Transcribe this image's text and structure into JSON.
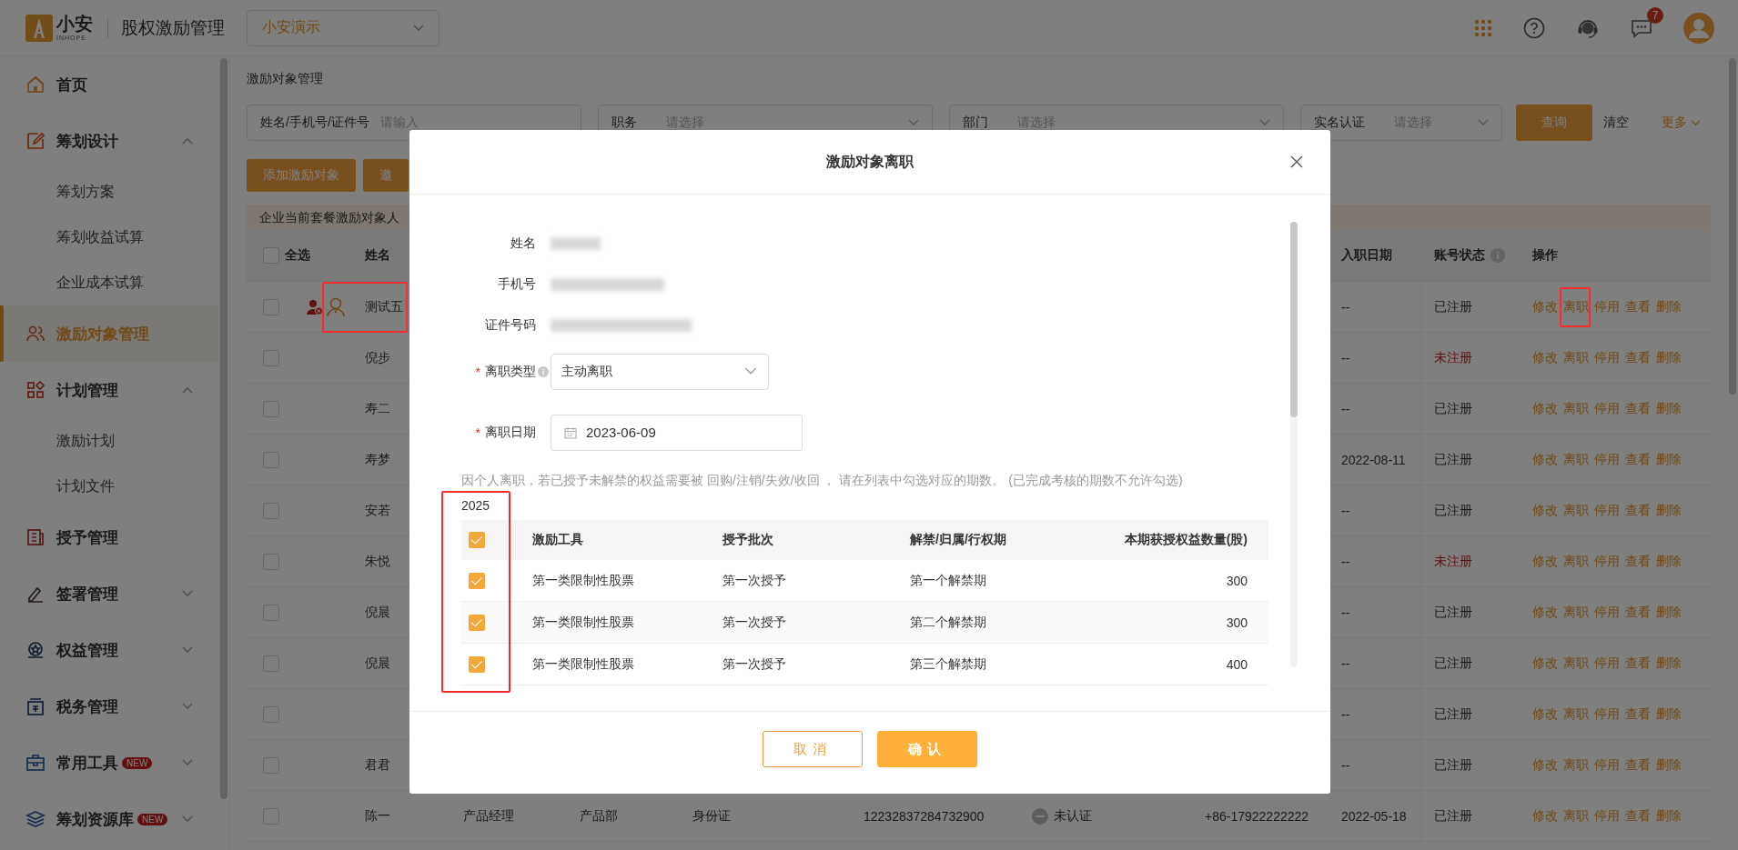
{
  "header": {
    "logo_text": "小安",
    "logo_sub": "INHOPE",
    "app_title": "股权激励管理",
    "company_select": "小安演示",
    "notification_count": "7"
  },
  "sidebar": {
    "items": [
      {
        "kind": "link",
        "label": "首页",
        "selected": false
      },
      {
        "kind": "group",
        "label": "筹划设计",
        "expanded": true,
        "selected": false,
        "children": [
          {
            "label": "筹划方案",
            "selected": false
          },
          {
            "label": "筹划收益试算",
            "selected": false
          },
          {
            "label": "企业成本试算",
            "selected": false
          }
        ]
      },
      {
        "kind": "link",
        "label": "激励对象管理",
        "selected": true
      },
      {
        "kind": "group",
        "label": "计划管理",
        "expanded": true,
        "selected": false,
        "children": [
          {
            "label": "激励计划",
            "selected": false
          },
          {
            "label": "计划文件",
            "selected": false
          }
        ]
      },
      {
        "kind": "link",
        "label": "授予管理",
        "selected": false
      },
      {
        "kind": "group",
        "label": "签署管理",
        "expanded": false,
        "selected": false
      },
      {
        "kind": "group",
        "label": "权益管理",
        "expanded": false,
        "selected": false
      },
      {
        "kind": "group",
        "label": "税务管理",
        "expanded": false,
        "selected": false
      },
      {
        "kind": "group",
        "label": "常用工具",
        "expanded": false,
        "selected": false,
        "badge": "NEW"
      },
      {
        "kind": "group",
        "label": "筹划资源库",
        "expanded": false,
        "selected": false,
        "badge": "NEW"
      }
    ]
  },
  "page": {
    "breadcrumb": "激励对象管理",
    "filters": [
      {
        "kind": "input",
        "label": "姓名/手机号/证件号",
        "placeholder": "请输入"
      },
      {
        "kind": "select",
        "label": "职务",
        "placeholder": "请选择"
      },
      {
        "kind": "select",
        "label": "部门",
        "placeholder": "请选择"
      },
      {
        "kind": "select",
        "label": "实名认证",
        "placeholder": "请选择"
      }
    ],
    "search_button": "查询",
    "clear_link": "清空",
    "more_link": "更多",
    "action_buttons": [
      "添加激励对象",
      "邀"
    ],
    "notice": "企业当前套餐激励对象人",
    "table": {
      "select_all": "全选",
      "select_all_checked": false,
      "name_column": "姓名",
      "right_columns": [
        {
          "label": "入职日期",
          "info": false
        },
        {
          "label": "账号状态",
          "info": true
        },
        {
          "label": "操作",
          "info": false
        }
      ],
      "rows": [
        {
          "checked": false,
          "tagged": true,
          "framed": true,
          "name": "测试五",
          "hire_date": "--",
          "status": "已注册",
          "registered": true,
          "actions": [
            "修改",
            "离职",
            "停用",
            "查看",
            "删除"
          ]
        },
        {
          "checked": false,
          "tagged": false,
          "framed": false,
          "name": "倪步",
          "hire_date": "--",
          "status": "未注册",
          "registered": false,
          "actions": [
            "修改",
            "离职",
            "停用",
            "查看",
            "删除"
          ]
        },
        {
          "checked": false,
          "tagged": false,
          "framed": false,
          "name": "寿二",
          "hire_date": "--",
          "status": "已注册",
          "registered": true,
          "actions": [
            "修改",
            "离职",
            "停用",
            "查看",
            "删除"
          ]
        },
        {
          "checked": false,
          "tagged": false,
          "framed": false,
          "name": "寿梦",
          "hire_date": "2022-08-11",
          "status": "已注册",
          "registered": true,
          "actions": [
            "修改",
            "离职",
            "停用",
            "查看",
            "删除"
          ]
        },
        {
          "checked": false,
          "tagged": false,
          "framed": false,
          "name": "安若",
          "hire_date": "--",
          "status": "已注册",
          "registered": true,
          "actions": [
            "修改",
            "离职",
            "停用",
            "查看",
            "删除"
          ]
        },
        {
          "checked": false,
          "tagged": false,
          "framed": false,
          "name": "朱悦",
          "hire_date": "--",
          "status": "未注册",
          "registered": false,
          "actions": [
            "修改",
            "离职",
            "停用",
            "查看",
            "删除"
          ]
        },
        {
          "checked": false,
          "tagged": false,
          "framed": false,
          "name": "倪晨",
          "hire_date": "--",
          "status": "已注册",
          "registered": true,
          "actions": [
            "修改",
            "离职",
            "停用",
            "查看",
            "删除"
          ]
        },
        {
          "checked": false,
          "tagged": false,
          "framed": false,
          "name": "倪晨",
          "hire_date": "--",
          "status": "已注册",
          "registered": true,
          "actions": [
            "修改",
            "离职",
            "停用",
            "查看",
            "删除"
          ]
        },
        {
          "checked": false,
          "tagged": false,
          "framed": false,
          "hire_date": "--",
          "status": "已注册",
          "registered": true,
          "actions": [
            "修改",
            "离职",
            "停用",
            "查看",
            "删除"
          ]
        },
        {
          "checked": false,
          "tagged": false,
          "framed": false,
          "name": "君君",
          "hire_date": "--",
          "status": "已注册",
          "registered": true,
          "actions": [
            "修改",
            "离职",
            "停用",
            "查看",
            "删除"
          ]
        },
        {
          "checked": false,
          "tagged": false,
          "framed": false,
          "name": "陈一",
          "details": {
            "position": "产品经理",
            "department": "产品部",
            "id_type": "身份证",
            "id_number": "12232837284732900",
            "verification": "未认证",
            "verified": false,
            "phone": "+86-17922222222"
          },
          "hire_date": "2022-05-18",
          "status": "已注册",
          "registered": true,
          "actions": [
            "修改",
            "离职",
            "停用",
            "查看",
            "删除"
          ]
        }
      ]
    }
  },
  "modal": {
    "title": "激励对象离职",
    "required_mark": "*",
    "fields": [
      {
        "kind": "redacted",
        "label": "姓名",
        "required": false,
        "info": false
      },
      {
        "kind": "redacted",
        "label": "手机号",
        "required": false,
        "info": false
      },
      {
        "kind": "redacted",
        "label": "证件号码",
        "required": false,
        "info": false
      },
      {
        "kind": "select",
        "label": "离职类型",
        "required": true,
        "info": true,
        "value": "主动离职"
      },
      {
        "kind": "date",
        "label": "离职日期",
        "required": true,
        "info": false,
        "value": "2023-06-09"
      }
    ],
    "note": "因个人离职，若已授予未解禁的权益需要被 回购/注销/失效/收回 ， 请在列表中勾选对应的期数。 (已完成考核的期数不允许勾选)",
    "year": "2025",
    "select_all_checked": true,
    "checkbox_column_framed": true,
    "columns": [
      "激励工具",
      "授予批次",
      "解禁/归属/行权期",
      "本期获授权益数量(股)"
    ],
    "rows": [
      {
        "checked": true,
        "tool": "第一类限制性股票",
        "batch": "第一次授予",
        "period": "第一个解禁期",
        "quantity": "300"
      },
      {
        "checked": true,
        "tool": "第一类限制性股票",
        "batch": "第一次授予",
        "period": "第二个解禁期",
        "quantity": "300"
      },
      {
        "checked": true,
        "tool": "第一类限制性股票",
        "batch": "第一次授予",
        "period": "第三个解禁期",
        "quantity": "400"
      }
    ],
    "cancel_button": "取消",
    "confirm_button": "确认"
  }
}
